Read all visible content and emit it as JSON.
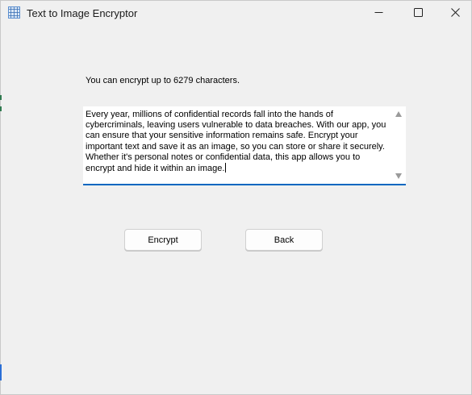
{
  "window": {
    "title": "Text to Image Encryptor",
    "icon": "app-grid-icon",
    "controls": [
      "minimize-icon",
      "maximize-icon",
      "close-icon"
    ]
  },
  "main": {
    "info_label": "You can encrypt up to 6279 characters.",
    "text_content": "Every year, millions of confidential records fall into the hands of cybercriminals, leaving users vulnerable to data breaches. With our app, you can ensure that your sensitive information remains safe. Encrypt your important text and save it as an image, so you can store or share it securely. Whether it's personal notes or confidential data, this app allows you to encrypt and hide it within an image.",
    "buttons": {
      "encrypt_label": "Encrypt",
      "back_label": "Back"
    }
  },
  "colors": {
    "background": "#f0f0f0",
    "accent": "#0067c0",
    "button_bg": "#fdfdfd"
  }
}
